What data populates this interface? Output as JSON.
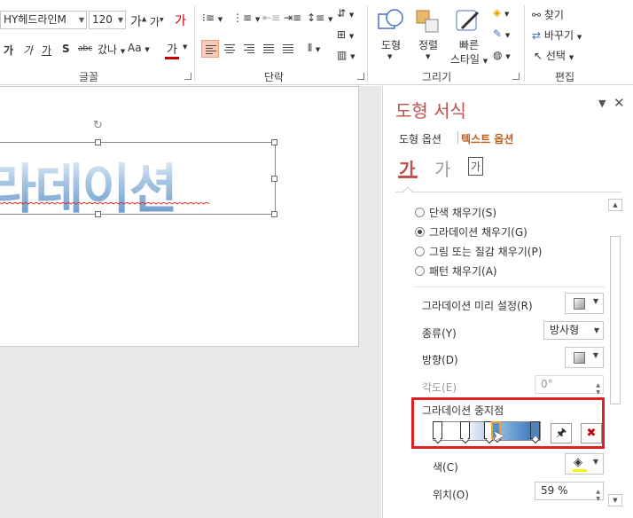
{
  "ribbon": {
    "font_name": "HY헤드라인M",
    "font_size": "120",
    "font_group": "글꼴",
    "para_group": "단락",
    "drawing_group": "그리기",
    "edit_group": "편집",
    "shape_label": "도형",
    "arrange_label": "정렬",
    "quick_style_label_1": "빠른",
    "quick_style_label_2": "스타일",
    "find_label": "찾기",
    "replace_label": "바꾸기",
    "select_label": "선택",
    "grow_font": "가",
    "shrink_font": "가",
    "bold": "가",
    "italic": "가",
    "underline": "가",
    "shadow": "S",
    "strike": "abc",
    "spacing": "갔나",
    "case": "Aa",
    "font_color": "가",
    "clear_format": "가"
  },
  "canvas": {
    "slide_text": "라데이션"
  },
  "pane": {
    "title": "도형 서식",
    "tab_shape": "도형 옵션",
    "tab_text": "텍스트 옵션",
    "subtab_fill": "가",
    "subtab_effect": "가",
    "subtab_textbox": "가",
    "fill_options": [
      {
        "label": "단색 채우기(S)",
        "selected": false
      },
      {
        "label": "그라데이션 채우기(G)",
        "selected": true
      },
      {
        "label": "그림 또는 질감 채우기(P)",
        "selected": false
      },
      {
        "label": "패턴 채우기(A)",
        "selected": false
      }
    ],
    "preset_label": "그라데이션 미리 설정(R)",
    "type_label": "종류(Y)",
    "type_value": "방사형",
    "direction_label": "방향(D)",
    "angle_label": "각도(E)",
    "angle_value": "0°",
    "stops_label": "그라데이션 중지점",
    "color_label": "색(C)",
    "position_label": "위치(O)",
    "position_value": "59 %"
  },
  "colors": {
    "accent": "#c0504d",
    "highlight_box": "#e02020",
    "text_tab": "#c55a11"
  }
}
